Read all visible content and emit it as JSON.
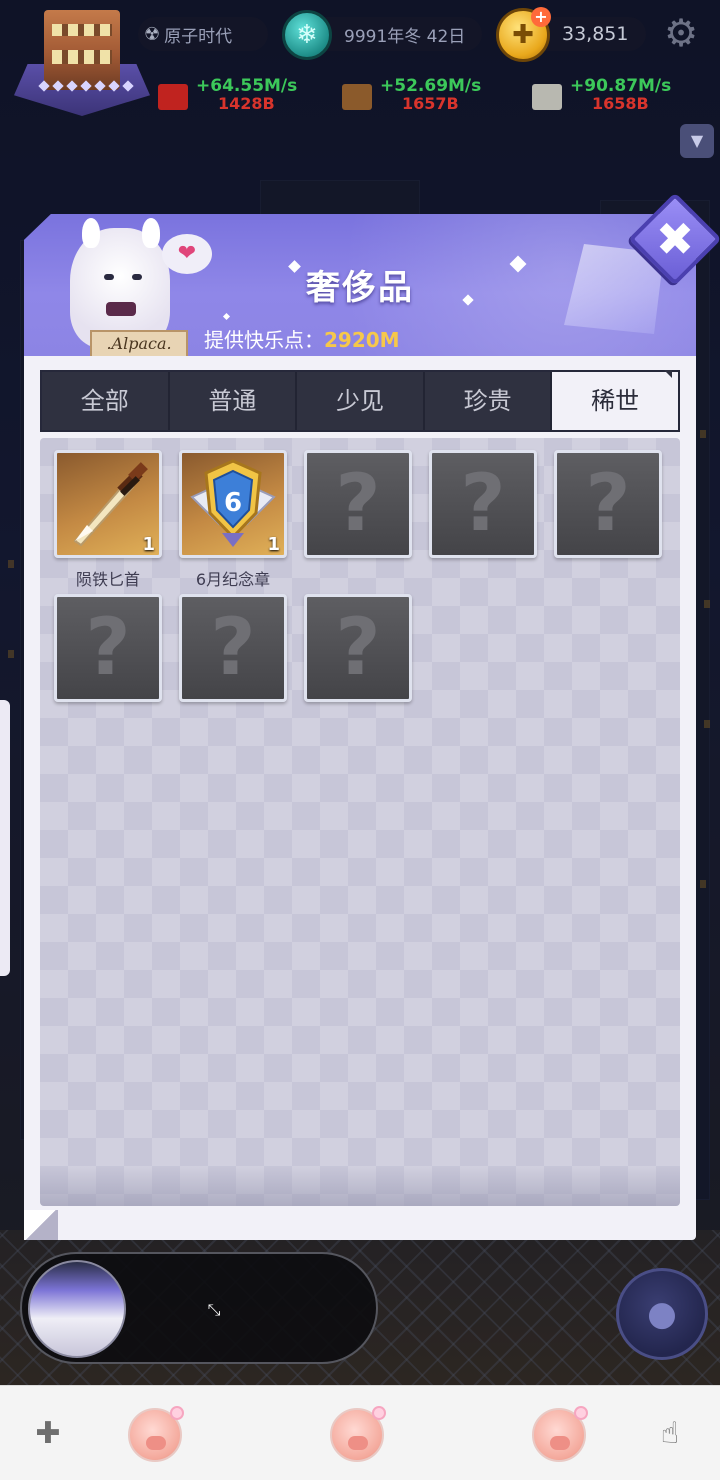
{
  "hud": {
    "era": "原子时代",
    "date": "9991年冬 42日",
    "coins": "33,851",
    "resources": [
      {
        "rate": "+64.55M/s",
        "amount": "1428B"
      },
      {
        "rate": "+52.69M/s",
        "amount": "1657B"
      },
      {
        "rate": "+90.87M/s",
        "amount": "1658B"
      }
    ]
  },
  "modal": {
    "title": "奢侈品",
    "subtitle_label": "提供快乐点：",
    "subtitle_value": "2920M",
    "sign_text": ".Alpaca.",
    "tabs": [
      {
        "label": "全部"
      },
      {
        "label": "普通"
      },
      {
        "label": "少见"
      },
      {
        "label": "珍贵"
      },
      {
        "label": "稀世",
        "active": true
      }
    ],
    "items": [
      {
        "name": "陨铁匕首",
        "count": "1",
        "icon": "dagger-icon",
        "unlocked": true
      },
      {
        "name": "6月纪念章",
        "count": "1",
        "badge_number": "6",
        "icon": "medal-icon",
        "unlocked": true
      },
      {
        "name": "",
        "icon": "question-mark-icon",
        "unlocked": false
      },
      {
        "name": "",
        "icon": "question-mark-icon",
        "unlocked": false
      },
      {
        "name": "",
        "icon": "question-mark-icon",
        "unlocked": false
      },
      {
        "name": "",
        "icon": "question-mark-icon",
        "unlocked": false
      },
      {
        "name": "",
        "icon": "question-mark-icon",
        "unlocked": false
      },
      {
        "name": "",
        "icon": "question-mark-icon",
        "unlocked": false
      }
    ],
    "locked_glyph": "?"
  },
  "icons": {
    "radiation": "☢",
    "snowflake": "❄",
    "gear": "⚙",
    "close": "✖",
    "heart": "❤",
    "dropdown": "▼",
    "expand": "⤡",
    "gamepad": "✚",
    "hand": "☝"
  },
  "colors": {
    "accent": "#8f87e8",
    "rate_green": "#3cc85a",
    "amount_red": "#d8342c",
    "value_gold": "#f6c84a"
  }
}
